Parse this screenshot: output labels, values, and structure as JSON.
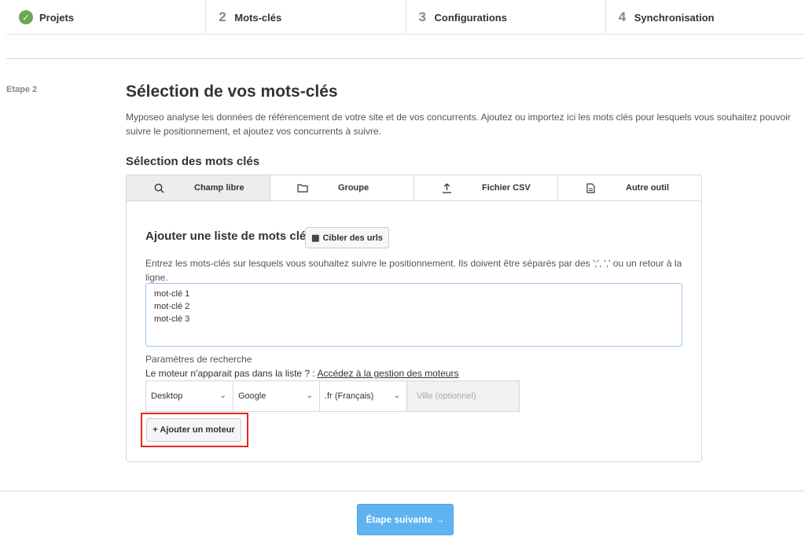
{
  "stepper": {
    "steps": [
      {
        "num": "",
        "label": "Projets",
        "done": true,
        "icon": "check-circle-icon"
      },
      {
        "num": "2",
        "label": "Mots-clés"
      },
      {
        "num": "3",
        "label": "Configurations"
      },
      {
        "num": "4",
        "label": "Synchronisation"
      }
    ]
  },
  "etape_label": "Etape 2",
  "page": {
    "title": "Sélection de vos mots-clés",
    "description": "Myposeo analyse les données de référencement de votre site et de vos concurrents. Ajoutez ou importez ici les mots clés pour lesquels vous souhaitez pouvoir suivre le positionnement, et ajoutez vos concurrents à suivre."
  },
  "selection": {
    "title": "Sélection des mots clés",
    "tabs": [
      {
        "label": "Champ libre",
        "icon": "search-icon",
        "active": true
      },
      {
        "label": "Groupe",
        "icon": "folder-icon"
      },
      {
        "label": "Fichier CSV",
        "icon": "upload-icon"
      },
      {
        "label": "Autre outil",
        "icon": "document-icon"
      }
    ]
  },
  "panel": {
    "subtitle": "Ajouter une liste de mots clés",
    "target_urls_label": "Cibler des urls",
    "hint": "Entrez les mots-clés sur lesquels vous souhaitez suivre le positionnement. Ils doivent être séparés par des ';', ',' ou un retour à la ligne.",
    "keywords": [
      "mot-clé 1",
      "mot-clé 2",
      "mot-clé 3"
    ],
    "params_label": "Paramètres de recherche",
    "engine_note": "Le moteur n'apparait pas dans la liste ? : ",
    "engine_link": "Accédez à la gestion des moteurs",
    "device": "Desktop",
    "engine": "Google",
    "locale": ".fr (Français)",
    "city_placeholder": "Ville (optionnel)",
    "add_engine_label": "+ Ajouter un moteur"
  },
  "next_button": "Étape suivante →",
  "colors": {
    "accent": "#5fb3f0",
    "done": "#6aa84f",
    "highlight": "#e0291f"
  }
}
